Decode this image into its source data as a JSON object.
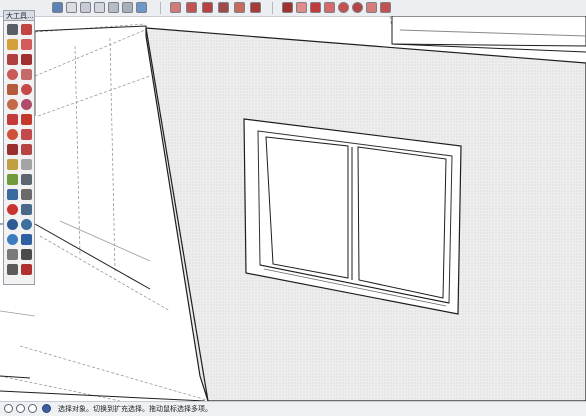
{
  "toolbar_window": {
    "title": "大工具..."
  },
  "top_toolbar": {
    "groups": [
      [
        "camera-icon",
        "iso-view-icon",
        "top-view-icon",
        "front-view-icon",
        "right-view-icon",
        "back-view-icon",
        "left-view-icon"
      ],
      [
        "xray-style-icon",
        "wireframe-style-icon",
        "hidden-line-style-icon",
        "shaded-style-icon",
        "textured-style-icon",
        "monochrome-style-icon"
      ],
      [
        "select-icon",
        "eraser-icon",
        "pencil-line-icon",
        "freehand-icon",
        "circle-icon",
        "arc-icon",
        "pie-icon",
        "two-point-arc-icon"
      ]
    ]
  },
  "left_toolbar": {
    "tools": [
      "select-arrow-icon",
      "component-icon",
      "paint-bucket-icon",
      "eraser-icon",
      "rectangle-icon",
      "line-icon",
      "circle-icon",
      "freehand-icon",
      "polygon-icon",
      "arc-icon",
      "pie-icon",
      "three-point-arc-icon",
      "move-icon",
      "push-pull-icon",
      "rotate-icon",
      "follow-me-icon",
      "scale-icon",
      "offset-icon",
      "tape-measure-icon",
      "dimension-icon",
      "protractor-icon",
      "text-icon",
      "axes-icon",
      "3d-text-icon",
      "orbit-icon",
      "pan-icon",
      "zoom-icon",
      "zoom-window-icon",
      "zoom-extents-icon",
      "previous-view-icon",
      "position-camera-icon",
      "look-around-icon",
      "walk-icon",
      "section-plane-icon"
    ]
  },
  "status_bar": {
    "icons": [
      "geo-location-icon",
      "info-icon",
      "credits-icon",
      "user-icon"
    ],
    "message": "选择对象。切换到扩充选择。拖动鼠标选择多项。"
  },
  "colors": {
    "wall_fill": "#ededed",
    "line_dark": "#1e1e1e",
    "line_guide": "#9a9a9a",
    "toolbar_bg": "#eceef2"
  }
}
